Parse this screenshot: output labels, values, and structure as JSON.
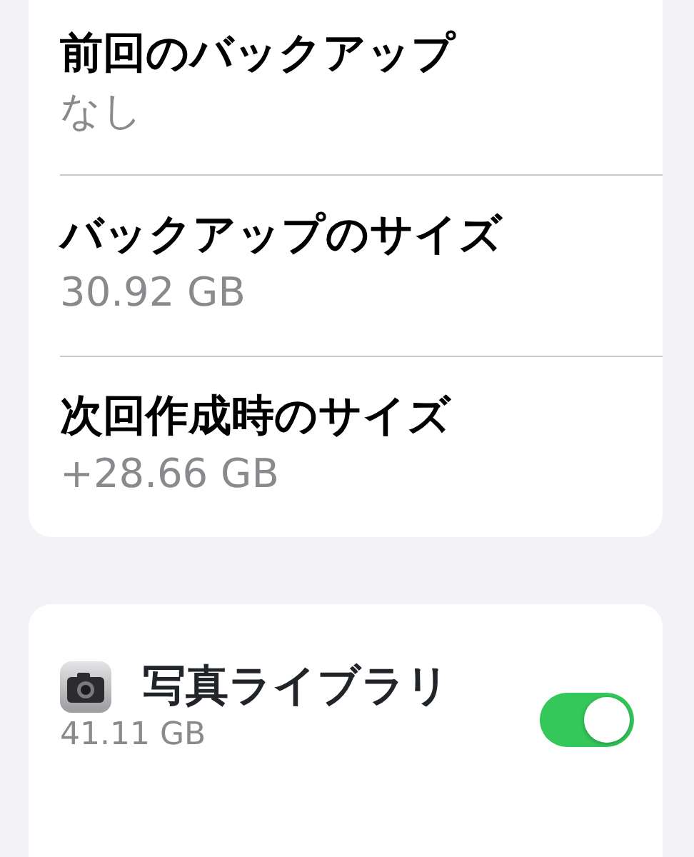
{
  "backup_info": [
    {
      "label": "前回のバックアップ",
      "value": "なし"
    },
    {
      "label": "バックアップのサイズ",
      "value": "30.92 GB"
    },
    {
      "label": "次回作成時のサイズ",
      "value": "+28.66 GB"
    }
  ],
  "apps": [
    {
      "name": "写真ライブラリ",
      "size": "41.11 GB",
      "on": true
    }
  ]
}
